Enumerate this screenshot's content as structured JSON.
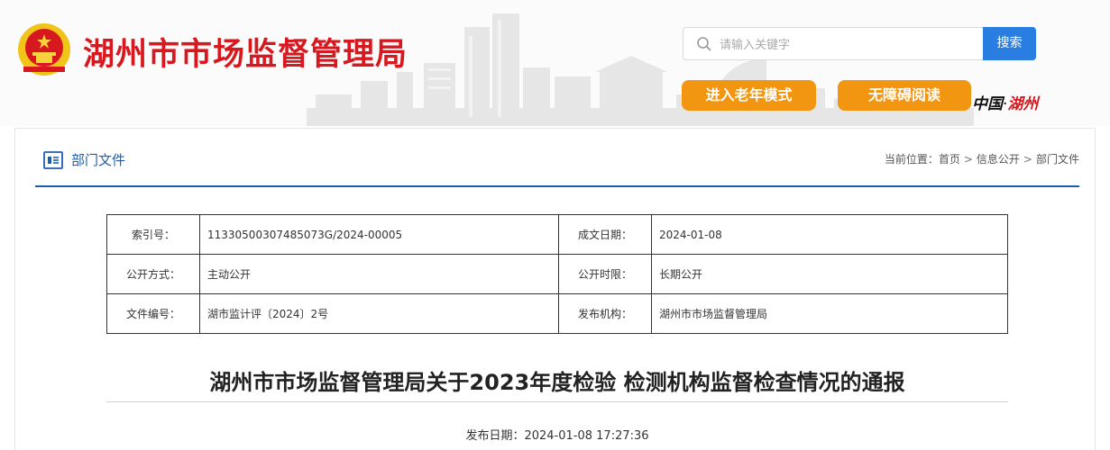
{
  "header": {
    "site_title": "湖州市市场监督管理局",
    "search": {
      "placeholder": "请输入关键字",
      "button_label": "搜索"
    },
    "elder_mode_label": "进入老年模式",
    "accessible_reading_label": "无障碍阅读",
    "slogan": {
      "china": "中国",
      "dot": "·",
      "huzhou": "湖州"
    },
    "colors": {
      "title_red": "#d8181f",
      "search_blue": "#2a7de1",
      "pill_orange": "#f29510"
    }
  },
  "section": {
    "title": "部门文件",
    "breadcrumb": {
      "prefix": "当前位置：",
      "items": [
        "首页",
        "信息公开",
        "部门文件"
      ],
      "separator": ">"
    }
  },
  "meta": {
    "rows": [
      {
        "label_left": "索引号：",
        "value_left": "11330500307485073G/2024-00005",
        "label_right": "成文日期：",
        "value_right": "2024-01-08"
      },
      {
        "label_left": "公开方式：",
        "value_left": "主动公开",
        "label_right": "公开时限：",
        "value_right": "长期公开"
      },
      {
        "label_left": "文件编号：",
        "value_left": "湖市监计评〔2024〕2号",
        "label_right": "发布机构：",
        "value_right": "湖州市市场监督管理局"
      }
    ]
  },
  "article": {
    "title": "湖州市市场监督管理局关于2023年度检验 检测机构监督检查情况的通报",
    "publish_label": "发布日期：",
    "publish_date": "2024-01-08 17:27:36"
  }
}
